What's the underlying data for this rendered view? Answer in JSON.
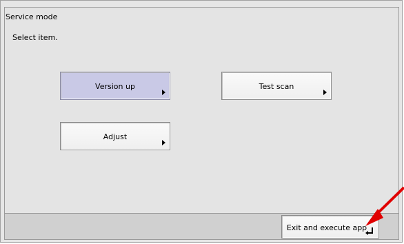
{
  "header": {
    "title": "Service mode"
  },
  "main": {
    "instruction": "Select item.",
    "buttons": [
      {
        "label": "Version up",
        "selected": true
      },
      {
        "label": "Test scan",
        "selected": false
      },
      {
        "label": "Adjust",
        "selected": false
      }
    ]
  },
  "footer": {
    "exit_label": "Exit and execute app"
  },
  "icons": {
    "submenu": "submenu-arrow-icon",
    "enter": "return-icon",
    "annotation": "red-arrow-pointer"
  },
  "colors": {
    "selected_button": "#c9c9e6",
    "annotation_arrow": "#e00000"
  }
}
